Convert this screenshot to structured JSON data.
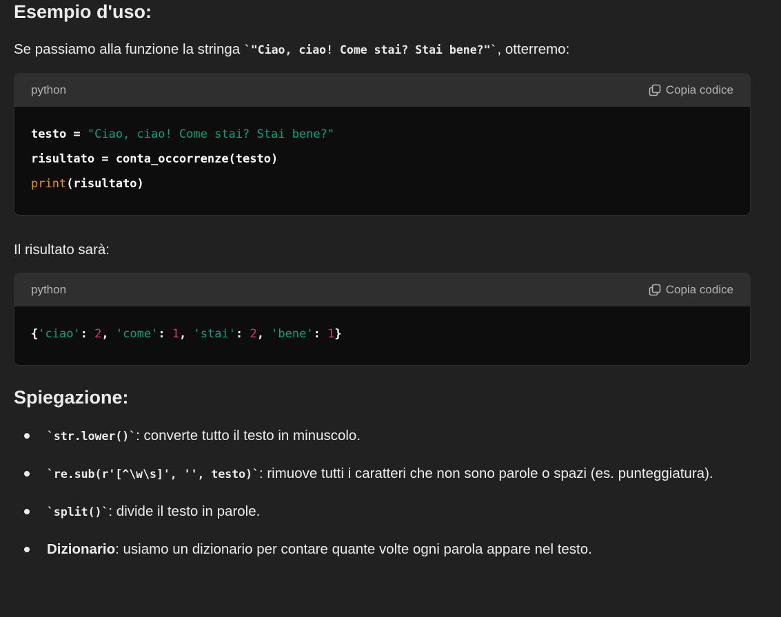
{
  "example": {
    "heading": "Esempio d'uso:",
    "intro_before": "Se passiamo alla funzione la stringa ",
    "intro_code": "`\"Ciao, ciao! Come stai? Stai bene?\"`",
    "intro_after": ", otterremo:"
  },
  "code_block_1": {
    "language": "python",
    "copy_label": "Copia codice",
    "copy_icon": "copy-icon",
    "lines": [
      {
        "a": "testo = ",
        "s": "\"Ciao, ciao! Come stai? Stai bene?\""
      },
      {
        "a": "risultato = conta_occorrenze(testo)"
      },
      {
        "f": "print",
        "a": "(risultato)"
      }
    ]
  },
  "result": {
    "text": "Il risultato sarà:"
  },
  "code_block_2": {
    "language": "python",
    "copy_label": "Copia codice",
    "copy_icon": "copy-icon",
    "tokens": [
      "{",
      "'ciao'",
      ": ",
      "2",
      ", ",
      "'come'",
      ": ",
      "1",
      ", ",
      "'stai'",
      ": ",
      "2",
      ", ",
      "'bene'",
      ": ",
      "1",
      "}"
    ]
  },
  "explanation": {
    "heading": "Spiegazione:",
    "items": [
      {
        "code": "`str.lower()`",
        "text": ": converte tutto il testo in minuscolo."
      },
      {
        "code": "`re.sub(r'[^\\w\\s]', '', testo)`",
        "text": ": rimuove tutti i caratteri che non sono parole o spazi (es. punteggiatura)."
      },
      {
        "code": "`split()`",
        "text": ": divide il testo in parole."
      },
      {
        "bold": "Dizionario",
        "text": ": usiamo un dizionario per contare quante volte ogni parola appare nel testo."
      }
    ]
  },
  "colors": {
    "background": "#212121",
    "code_background": "#0d0d0d",
    "code_header": "#2f2f2f",
    "string": "#00a67d",
    "number": "#df3079",
    "builtin": "#e9950c"
  }
}
